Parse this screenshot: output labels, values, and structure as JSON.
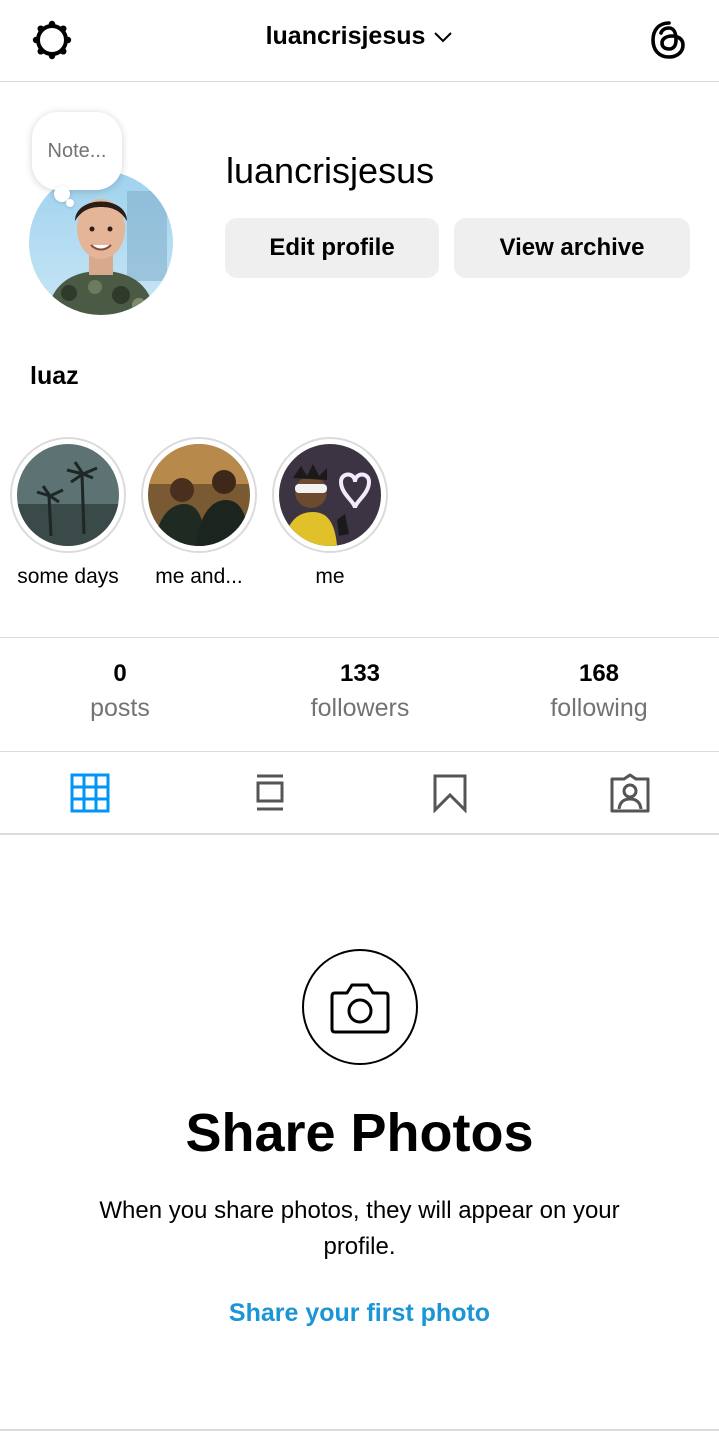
{
  "header": {
    "username": "luancrisjesus",
    "settings_icon": "gear-icon",
    "threads_icon": "threads-icon"
  },
  "profile": {
    "note_placeholder": "Note...",
    "username": "luancrisjesus",
    "display_name": "luaz",
    "edit_label": "Edit profile",
    "archive_label": "View archive"
  },
  "highlights": [
    {
      "label": "some days"
    },
    {
      "label": "me and..."
    },
    {
      "label": "me"
    }
  ],
  "stats": [
    {
      "value": "0",
      "label": "posts"
    },
    {
      "value": "133",
      "label": "followers"
    },
    {
      "value": "168",
      "label": "following"
    }
  ],
  "tabs": [
    {
      "icon": "grid-icon",
      "active": true
    },
    {
      "icon": "feed-icon",
      "active": false
    },
    {
      "icon": "bookmark-icon",
      "active": false
    },
    {
      "icon": "tagged-icon",
      "active": false
    }
  ],
  "empty": {
    "title": "Share Photos",
    "subtitle": "When you share photos, they will appear on your profile.",
    "link": "Share your first photo"
  },
  "colors": {
    "accent": "#0095f6",
    "link": "#1a95d6",
    "button_bg": "#efefef",
    "muted_text": "#737373",
    "divider": "#dbdbdb"
  }
}
